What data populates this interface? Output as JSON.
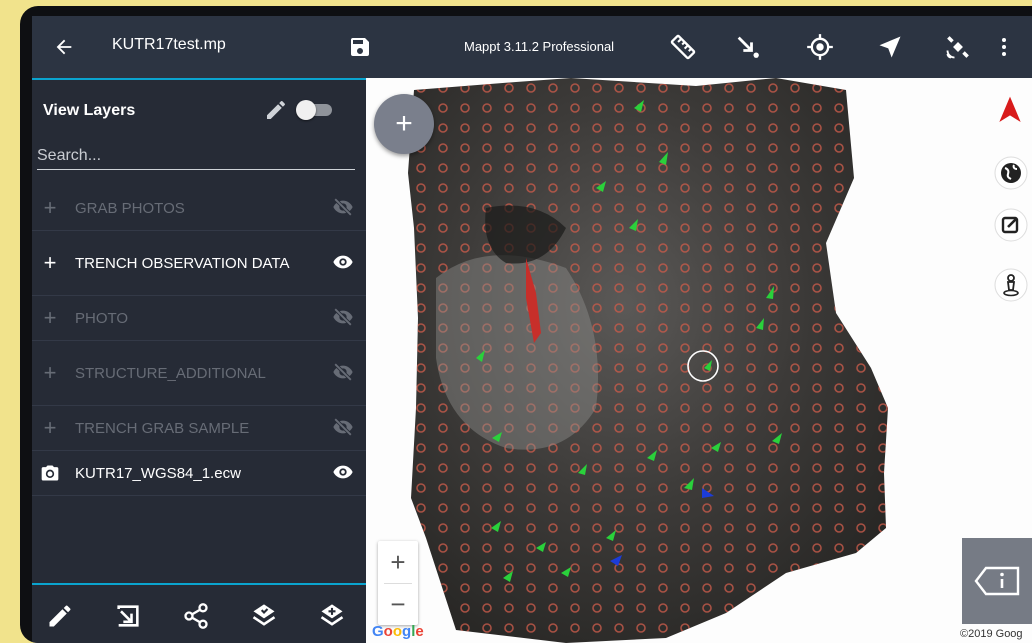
{
  "toolbar": {
    "back_icon": "arrow-back-icon",
    "file_name": "KUTR17test.mp",
    "save_icon": "save-icon",
    "app_version": "Mappt 3.11.2 Professional",
    "icons": [
      "ruler-icon",
      "arrow-point-icon",
      "gps-target-icon",
      "navigation-arrow-icon",
      "satellite-icon",
      "more-vertical-icon"
    ]
  },
  "panel": {
    "title": "View Layers",
    "edit_icon": "pencil-icon",
    "toggle_on": false,
    "search_placeholder": "Search...",
    "layers": [
      {
        "icon": "plus-icon",
        "name": "GRAB PHOTOS",
        "visible": false
      },
      {
        "icon": "plus-icon",
        "name": "TRENCH OBSERVATION DATA",
        "visible": true
      },
      {
        "icon": "plus-icon",
        "name": "PHOTO",
        "visible": false
      },
      {
        "icon": "plus-icon",
        "name": "STRUCTURE_ADDITIONAL",
        "visible": false
      },
      {
        "icon": "plus-icon",
        "name": "TRENCH GRAB SAMPLE",
        "visible": false
      },
      {
        "icon": "camera-icon",
        "name": "KUTR17_WGS84_1.ecw",
        "visible": true
      }
    ],
    "bottom_icons": [
      "edit-icon",
      "import-icon",
      "share-icon",
      "layers-icon",
      "layers-add-icon"
    ]
  },
  "map": {
    "fab_label": "+",
    "zoom_in": "+",
    "zoom_out": "−",
    "provider": "Google",
    "copyright": "©2019 Goog",
    "right_controls": [
      "compass-north-icon",
      "globe-icon",
      "edit-box-icon",
      "person-pin-icon"
    ],
    "info_icon": "label-info-icon",
    "colors": {
      "accent": "#0aa4cf",
      "toolbar": "#2c3442",
      "panel": "#262b36",
      "compass": "#d81b1b"
    }
  }
}
